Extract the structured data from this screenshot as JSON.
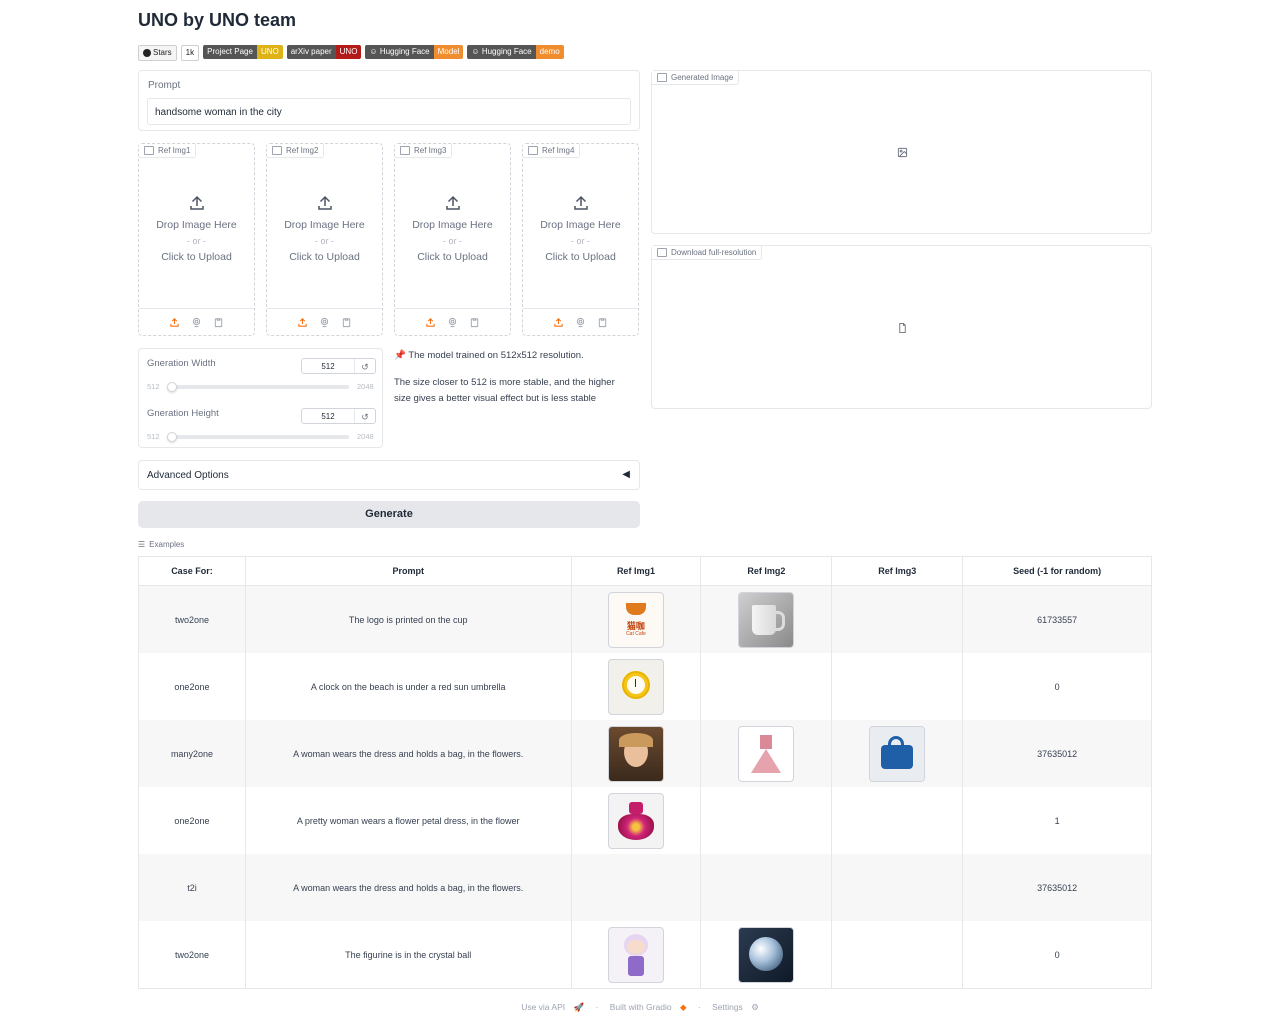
{
  "app": {
    "title": "UNO by UNO team"
  },
  "badges": [
    {
      "left": "Stars",
      "right": "1k",
      "color": ""
    },
    {
      "left": "Project Page",
      "right": "UNO",
      "color": "#dfb317"
    },
    {
      "left": "arXiv paper",
      "right": "UNO",
      "color": "#b31b1b"
    },
    {
      "left": "Hugging Face",
      "right": "Model",
      "color": "#f08d2e"
    },
    {
      "left": "Hugging Face",
      "right": "demo",
      "color": "#f08d2e"
    }
  ],
  "prompt": {
    "label": "Prompt",
    "value": "handsome woman in the city"
  },
  "ref_images": [
    {
      "label": "Ref Img1"
    },
    {
      "label": "Ref Img2"
    },
    {
      "label": "Ref Img3"
    },
    {
      "label": "Ref Img4"
    }
  ],
  "upload": {
    "drop_text": "Drop Image Here",
    "or_text": "- or -",
    "click_text": "Click to Upload"
  },
  "width_slider": {
    "label": "Gneration Width",
    "value": "512",
    "min": "512",
    "max": "2048",
    "fraction": 0.0
  },
  "height_slider": {
    "label": "Gneration Height",
    "value": "512",
    "min": "512",
    "max": "2048",
    "fraction": 0.0
  },
  "notes": {
    "line1": "The model trained on 512x512 resolution.",
    "line2": "The size closer to 512 is more stable, and the higher size gives a better visual effect but is less stable"
  },
  "advanced": {
    "label": "Advanced Options",
    "arrow": "◀"
  },
  "generate": {
    "label": "Generate"
  },
  "output": {
    "generated_label": "Generated Image",
    "download_label": "Download full-resolution"
  },
  "examples": {
    "label": "Examples",
    "headers": [
      "Case For:",
      "Prompt",
      "Ref Img1",
      "Ref Img2",
      "Ref Img3",
      "Seed (-1 for random)"
    ],
    "rows": [
      {
        "case": "two2one",
        "prompt": "The logo is printed on the cup",
        "imgs": [
          "logo-cup",
          "mug",
          ""
        ],
        "seed": "61733557"
      },
      {
        "case": "one2one",
        "prompt": "A clock on the beach is under a red sun umbrella",
        "imgs": [
          "clock",
          "",
          ""
        ],
        "seed": "0"
      },
      {
        "case": "many2one",
        "prompt": "A woman wears the dress and holds a bag, in the flowers.",
        "imgs": [
          "woman",
          "dress",
          "bag"
        ],
        "seed": "37635012"
      },
      {
        "case": "one2one",
        "prompt": "A pretty woman wears a flower petal dress, in the flower",
        "imgs": [
          "petal-dress",
          "",
          ""
        ],
        "seed": "1"
      },
      {
        "case": "t2i",
        "prompt": "A woman wears the dress and holds a bag, in the flowers.",
        "imgs": [
          "",
          "",
          ""
        ],
        "seed": "37635012"
      },
      {
        "case": "two2one",
        "prompt": "The figurine is in the crystal ball",
        "imgs": [
          "figurine",
          "crystal-ball",
          ""
        ],
        "seed": "0"
      }
    ],
    "logo_text": "猫咖",
    "logo_sub": "Cat Cafe"
  },
  "footer": {
    "api": "Use via API",
    "built": "Built with Gradio",
    "settings": "Settings",
    "sep": "·"
  }
}
